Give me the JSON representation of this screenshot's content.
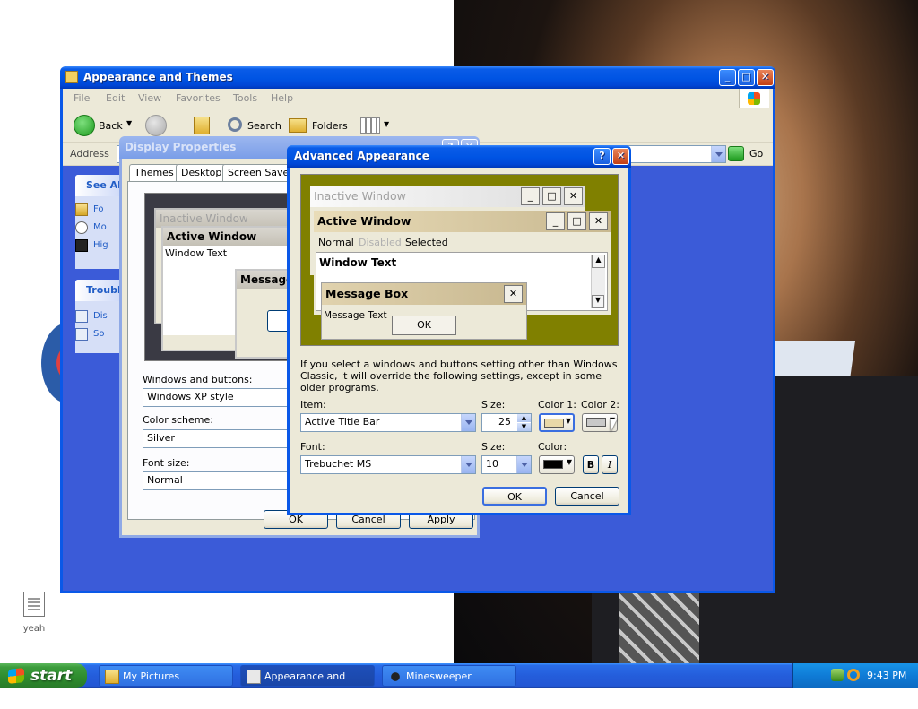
{
  "desktop": {
    "icon_label": "yeah"
  },
  "explorer": {
    "title": "Appearance and Themes",
    "menu": [
      "File",
      "Edit",
      "View",
      "Favorites",
      "Tools",
      "Help"
    ],
    "toolbar": {
      "back": "Back",
      "search": "Search",
      "folders": "Folders"
    },
    "address_label": "Address",
    "go_label": "Go",
    "taskpane1": {
      "title": "See Al",
      "items": [
        "Fo",
        "Mo",
        "Hig"
      ]
    },
    "taskpane2": {
      "title": "Troubl",
      "items": [
        "Dis",
        "So"
      ]
    }
  },
  "display_properties": {
    "title": "Display Properties",
    "tabs": [
      "Themes",
      "Desktop",
      "Screen Saver"
    ],
    "preview": {
      "inactive": "Inactive Window",
      "active": "Active Window",
      "window_text": "Window Text",
      "message": "Message"
    },
    "windows_buttons_label": "Windows and buttons:",
    "windows_buttons_value": "Windows XP style",
    "color_scheme_label": "Color scheme:",
    "color_scheme_value": "Silver",
    "font_size_label": "Font size:",
    "font_size_value": "Normal",
    "ok": "OK",
    "cancel": "Cancel",
    "apply": "Apply"
  },
  "advanced": {
    "title": "Advanced Appearance",
    "preview": {
      "inactive": "Inactive Window",
      "active": "Active Window",
      "menu_normal": "Normal",
      "menu_disabled": "Disabled",
      "menu_selected": "Selected",
      "window_text": "Window Text",
      "message_box": "Message Box",
      "message_text": "Message Text",
      "ok": "OK"
    },
    "note": "If you select a windows and buttons setting other than Windows Classic, it will override the following settings, except in some older programs.",
    "item_label": "Item:",
    "item_value": "Active Title Bar",
    "size_label": "Size:",
    "size_value": "25",
    "color1_label": "Color 1:",
    "color2_label": "Color 2:",
    "font_label": "Font:",
    "font_value": "Trebuchet MS",
    "font_size_label": "Size:",
    "font_size_value": "10",
    "font_color_label": "Color:",
    "bold": "B",
    "italic": "I",
    "ok": "OK",
    "cancel": "Cancel",
    "colors": {
      "color1": "#e8d8a8",
      "color2": "#c8c8c8",
      "font_color": "#000000",
      "preview_bg": "#808000"
    }
  },
  "taskbar": {
    "start": "start",
    "tasks": [
      "My Pictures",
      "Appearance and The...",
      "Minesweeper"
    ],
    "clock": "9:43 PM"
  }
}
